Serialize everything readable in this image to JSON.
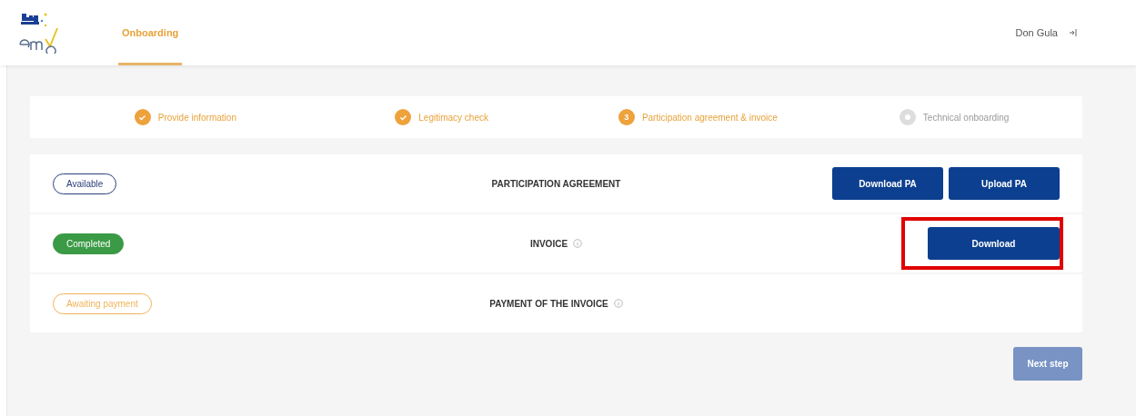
{
  "header": {
    "nav": [
      {
        "label": "Onboarding",
        "selected": true
      }
    ],
    "user": "Don Gula"
  },
  "stepper": [
    {
      "label": "Provide information",
      "kind": "done"
    },
    {
      "label": "Legitimacy check",
      "kind": "done"
    },
    {
      "label": "Participation agreement & invoice",
      "kind": "current",
      "number": "3"
    },
    {
      "label": "Technical onboarding",
      "kind": "upcoming"
    }
  ],
  "rows": [
    {
      "badge": {
        "label": "Available",
        "kind": "outline",
        "color": "#2c3e7a"
      },
      "title": "PARTICIPATION AGREEMENT",
      "actions": [
        {
          "label": "Download PA",
          "highlighted": false
        },
        {
          "label": "Upload PA",
          "highlighted": false
        }
      ]
    },
    {
      "badge": {
        "label": "Completed",
        "kind": "filled",
        "color": "#3a9a45"
      },
      "title": "INVOICE",
      "info": true,
      "actions": [
        {
          "label": "Download",
          "highlighted": true
        }
      ]
    },
    {
      "badge": {
        "label": "Awaiting payment",
        "kind": "outline",
        "color": "#f0b45a"
      },
      "title": "PAYMENT OF THE INVOICE",
      "info": true,
      "actions": []
    }
  ],
  "next_button": {
    "label": "Next step",
    "disabled": true
  }
}
